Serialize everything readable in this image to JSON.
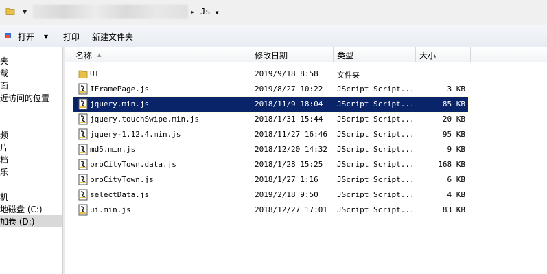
{
  "address": {
    "current_folder": "Js",
    "blurred_path": ""
  },
  "toolbar": {
    "open_label": "打开",
    "print_label": "打印",
    "new_folder_label": "新建文件夹"
  },
  "nav": {
    "items": [
      "夹",
      "载",
      "面",
      "近访问的位置",
      "频",
      "片",
      "档",
      "乐",
      "机",
      "地磁盘 (C:)",
      "加卷 (D:)"
    ],
    "selected_index": 10
  },
  "columns": {
    "name": "名称",
    "modified": "修改日期",
    "type": "类型",
    "size": "大小"
  },
  "files": [
    {
      "name": "UI",
      "modified": "2019/9/18 8:58",
      "type": "文件夹",
      "size": "",
      "icon": "folder-icon"
    },
    {
      "name": "IFramePage.js",
      "modified": "2019/8/27 10:22",
      "type": "JScript Script...",
      "size": "3 KB",
      "icon": "jscript-file-icon"
    },
    {
      "name": "jquery.min.js",
      "modified": "2018/11/9 18:04",
      "type": "JScript Script...",
      "size": "85 KB",
      "icon": "jscript-file-icon"
    },
    {
      "name": "jquery.touchSwipe.min.js",
      "modified": "2018/1/31 15:44",
      "type": "JScript Script...",
      "size": "20 KB",
      "icon": "jscript-file-icon"
    },
    {
      "name": "jquery-1.12.4.min.js",
      "modified": "2018/11/27 16:46",
      "type": "JScript Script...",
      "size": "95 KB",
      "icon": "jscript-file-icon"
    },
    {
      "name": "md5.min.js",
      "modified": "2018/12/20 14:32",
      "type": "JScript Script...",
      "size": "9 KB",
      "icon": "jscript-file-icon"
    },
    {
      "name": "proCityTown.data.js",
      "modified": "2018/1/28 15:25",
      "type": "JScript Script...",
      "size": "168 KB",
      "icon": "jscript-file-icon"
    },
    {
      "name": "proCityTown.js",
      "modified": "2018/1/27 1:16",
      "type": "JScript Script...",
      "size": "6 KB",
      "icon": "jscript-file-icon"
    },
    {
      "name": "selectData.js",
      "modified": "2019/2/18 9:50",
      "type": "JScript Script...",
      "size": "4 KB",
      "icon": "jscript-file-icon"
    },
    {
      "name": "ui.min.js",
      "modified": "2018/12/27 17:01",
      "type": "JScript Script...",
      "size": "83 KB",
      "icon": "jscript-file-icon"
    }
  ],
  "selected_file_index": 2,
  "colors": {
    "selection": "#0a246a",
    "toolbar_bg": "#eef1f5"
  }
}
